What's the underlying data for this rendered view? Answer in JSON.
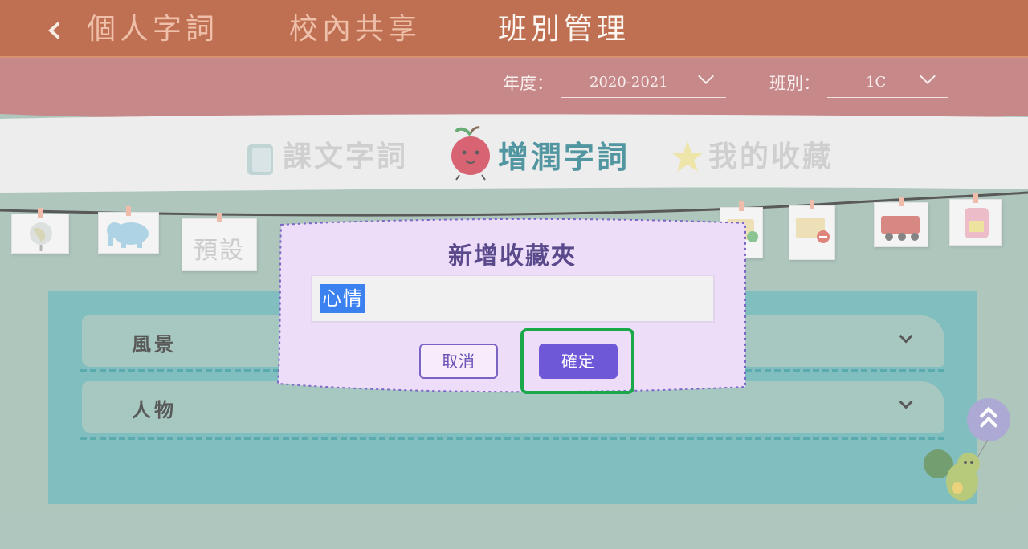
{
  "nav": {
    "back_icon": "chevron-left-icon",
    "tabs": [
      {
        "label": "個人字詞"
      },
      {
        "label": "校內共享"
      },
      {
        "label": "班別管理"
      }
    ]
  },
  "filters": {
    "year_label": "年度：",
    "year_value": "2020-2021",
    "class_label": "班別：",
    "class_value": "1C"
  },
  "categories": [
    {
      "label": "課文字詞",
      "icon": "book-icon"
    },
    {
      "label": "增潤字詞",
      "icon": "apple-icon"
    },
    {
      "label": "我的收藏",
      "icon": "star-icon"
    }
  ],
  "bunting": {
    "default_flag": "預設",
    "icons": [
      "globe-icon",
      "elephant-icon",
      "folder-add-icon",
      "folder-remove-icon",
      "train-icon",
      "backpack-icon"
    ]
  },
  "folders": [
    {
      "name": "風景"
    },
    {
      "name": "人物"
    }
  ],
  "modal": {
    "title": "新增收藏夾",
    "input_value": "心情",
    "cancel_label": "取消",
    "confirm_label": "確定"
  },
  "colors": {
    "nav_bg": "#a83a10",
    "filter_bg": "#b25b5e",
    "panel_bg": "#4fa5a7",
    "modal_bg": "#eeddf9",
    "confirm_bg": "#6e58d8",
    "highlight": "#1aa84b"
  }
}
